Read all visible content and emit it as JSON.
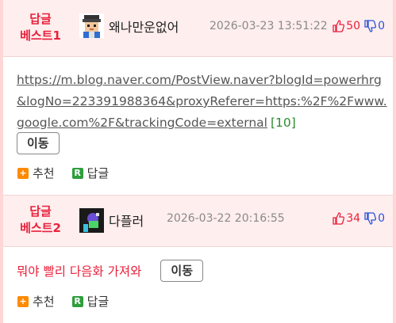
{
  "comments": [
    {
      "badge_line1": "답글",
      "badge_line2": "베스트1",
      "nickname": "왜나만운없어",
      "date": "2026-03-23 13:51:22",
      "upvotes": "50",
      "downvotes": "0",
      "link_text": "https://m.blog.naver.com/PostView.naver?blogId=powerhrg&logNo=223391988364&proxyReferer=https:%2F%2Fwww.google.com%2F&trackingCode=external",
      "link_count": "[10]",
      "move_label": "이동",
      "recommend_label": "추천",
      "reply_label": "답글"
    },
    {
      "badge_line1": "답글",
      "badge_line2": "베스트2",
      "nickname": "다플러",
      "date": "2026-03-22 20:16:55",
      "upvotes": "34",
      "downvotes": "0",
      "body_text": "뭐야 빨리 다음화 가져와",
      "move_label": "이동",
      "recommend_label": "추천",
      "reply_label": "답글"
    }
  ],
  "colors": {
    "best": "#e8213c",
    "header_bg": "#ffeeee",
    "page_bg": "#ffd7d7",
    "down": "#2a52d9",
    "link_count": "#2f8a2f"
  }
}
